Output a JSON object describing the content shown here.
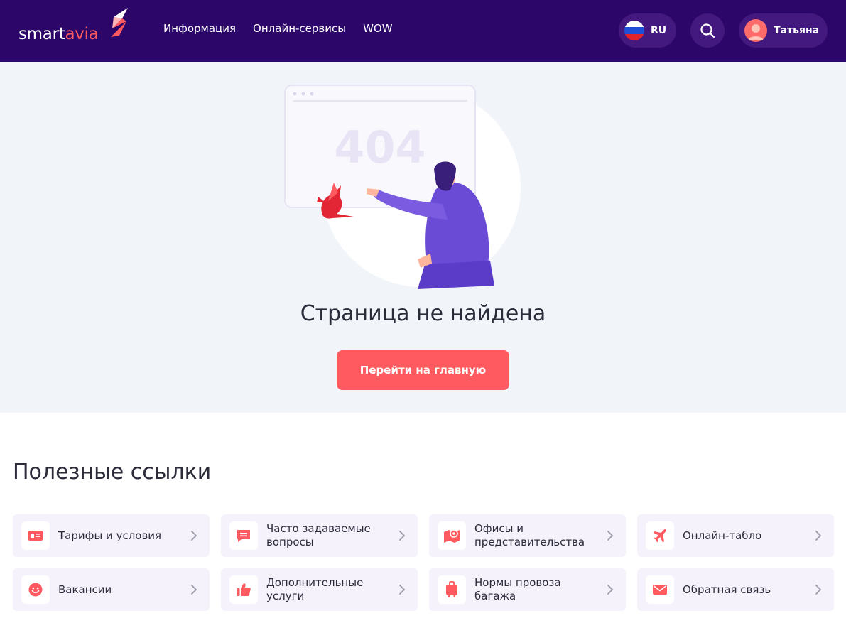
{
  "header": {
    "logo": {
      "part1": "smart",
      "part2": "avia"
    },
    "nav": [
      {
        "label": "Информация"
      },
      {
        "label": "Онлайн-сервисы"
      },
      {
        "label": "WOW"
      }
    ],
    "language": "RU",
    "user_name": "Татьяна"
  },
  "hero": {
    "illustration_code": "404",
    "title": "Страница не найдена",
    "home_button": "Перейти на главную"
  },
  "links": {
    "title": "Полезные ссылки",
    "items": [
      {
        "label": "Тарифы и условия",
        "icon": "ticket-icon"
      },
      {
        "label": "Часто задаваемые вопросы",
        "icon": "chat-icon"
      },
      {
        "label": "Офисы и представительства",
        "icon": "map-pin-icon"
      },
      {
        "label": "Онлайн-табло",
        "icon": "plane-icon"
      },
      {
        "label": "Вакансии",
        "icon": "smile-icon"
      },
      {
        "label": "Дополнительные услуги",
        "icon": "thumbs-up-icon"
      },
      {
        "label": "Нормы провоза багажа",
        "icon": "luggage-icon"
      },
      {
        "label": "Обратная связь",
        "icon": "mail-icon"
      }
    ]
  },
  "colors": {
    "header_bg": "#2c0669",
    "accent": "#ff5a60",
    "hero_bg": "#f1f4f9",
    "card_bg": "#f6f2fc"
  }
}
